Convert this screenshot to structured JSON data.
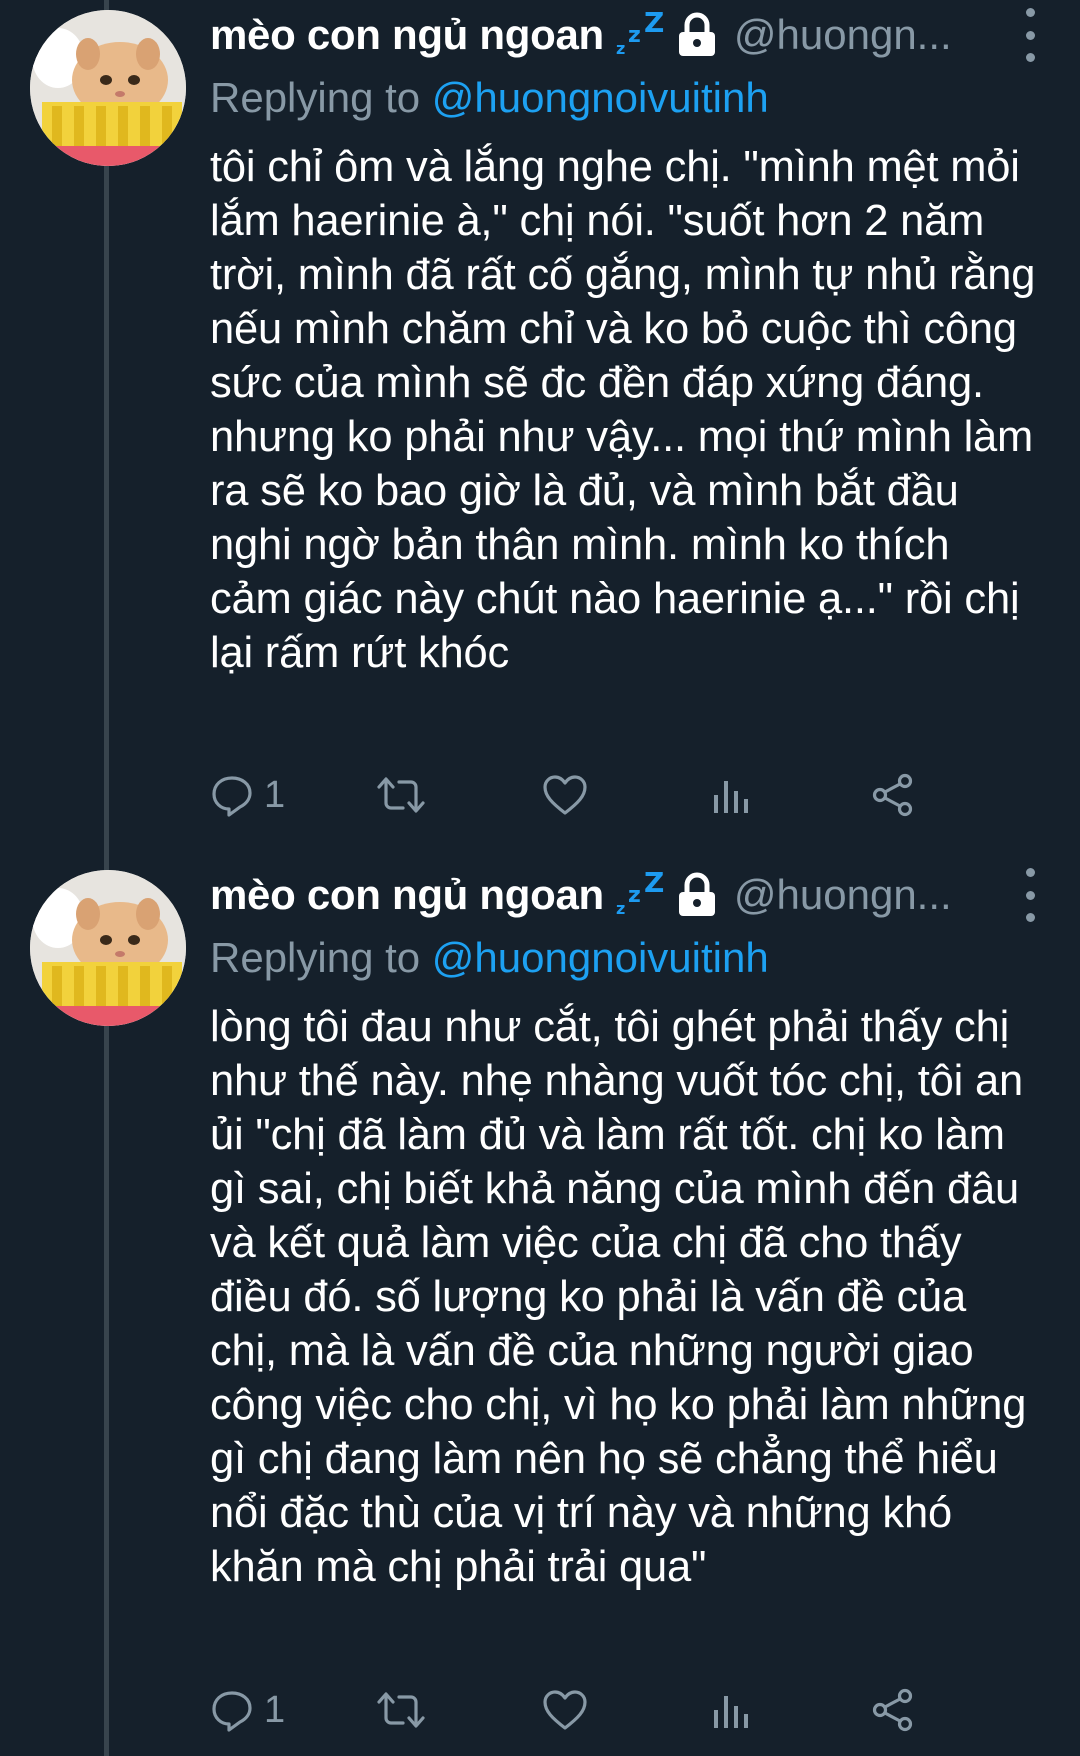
{
  "colors": {
    "background": "#15202b",
    "text": "#ffffff",
    "muted": "#8899a6",
    "accent": "#1da1f2",
    "thread_line": "#38444d"
  },
  "tweets": [
    {
      "display_name": "mèo con ngủ ngoan",
      "name_icons": [
        "zzz-icon",
        "lock-icon"
      ],
      "handle": "@huongn...",
      "replying_label": "Replying to",
      "replying_mention": "@huongnoivuitinh",
      "text": "tôi chỉ ôm và lắng nghe chị. \"mình mệt mỏi lắm haerinie à,\" chị nói. \"suốt hơn 2 năm trời, mình đã rất cố gắng, mình tự nhủ rằng nếu mình chăm chỉ và ko bỏ cuộc thì công sức của mình sẽ đc đền đáp xứng đáng. nhưng ko phải như vậy... mọi thứ mình làm ra sẽ ko bao giờ là đủ, và mình bắt đầu nghi ngờ bản thân mình. mình ko thích cảm giác này chút nào haerinie ạ...\" rồi chị lại rấm rứt khóc",
      "reply_count": "1",
      "actions": [
        "reply-icon",
        "retweet-icon",
        "like-icon",
        "analytics-icon",
        "share-icon"
      ]
    },
    {
      "display_name": "mèo con ngủ ngoan",
      "name_icons": [
        "zzz-icon",
        "lock-icon"
      ],
      "handle": "@huongn...",
      "replying_label": "Replying to",
      "replying_mention": "@huongnoivuitinh",
      "text": "lòng tôi đau như cắt, tôi ghét phải thấy chị như thế này. nhẹ nhàng vuốt tóc chị, tôi an ủi \"chị đã làm đủ và làm rất tốt. chị ko làm gì sai, chị biết khả năng của mình đến đâu và kết quả làm việc của chị đã cho thấy điều đó. số lượng ko phải là vấn đề của chị, mà là vấn đề của những người giao công việc cho chị, vì họ ko phải làm những gì chị đang làm nên họ sẽ chẳng thể hiểu nổi đặc thù của vị trí này và những khó khăn mà chị phải trải qua\"",
      "reply_count": "1",
      "actions": [
        "reply-icon",
        "retweet-icon",
        "like-icon",
        "analytics-icon",
        "share-icon"
      ]
    }
  ]
}
